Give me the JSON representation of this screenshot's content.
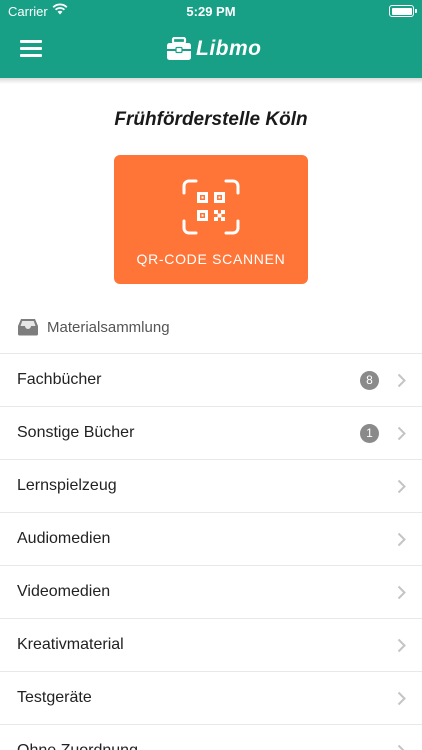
{
  "status_bar": {
    "carrier": "Carrier",
    "time": "5:29 PM"
  },
  "header": {
    "app_name": "Libmo",
    "brand_color": "#17a086"
  },
  "organization": {
    "name": "Frühförderstelle Köln"
  },
  "scan_button": {
    "label": "QR-CODE SCANNEN",
    "color": "#ff7537"
  },
  "section": {
    "label": "Materialsammlung"
  },
  "categories": [
    {
      "label": "Fachbücher",
      "count": "8"
    },
    {
      "label": "Sonstige Bücher",
      "count": "1"
    },
    {
      "label": "Lernspielzeug"
    },
    {
      "label": "Audiomedien"
    },
    {
      "label": "Videomedien"
    },
    {
      "label": "Kreativmaterial"
    },
    {
      "label": "Testgeräte"
    },
    {
      "label": "Ohne Zuordnung"
    }
  ]
}
